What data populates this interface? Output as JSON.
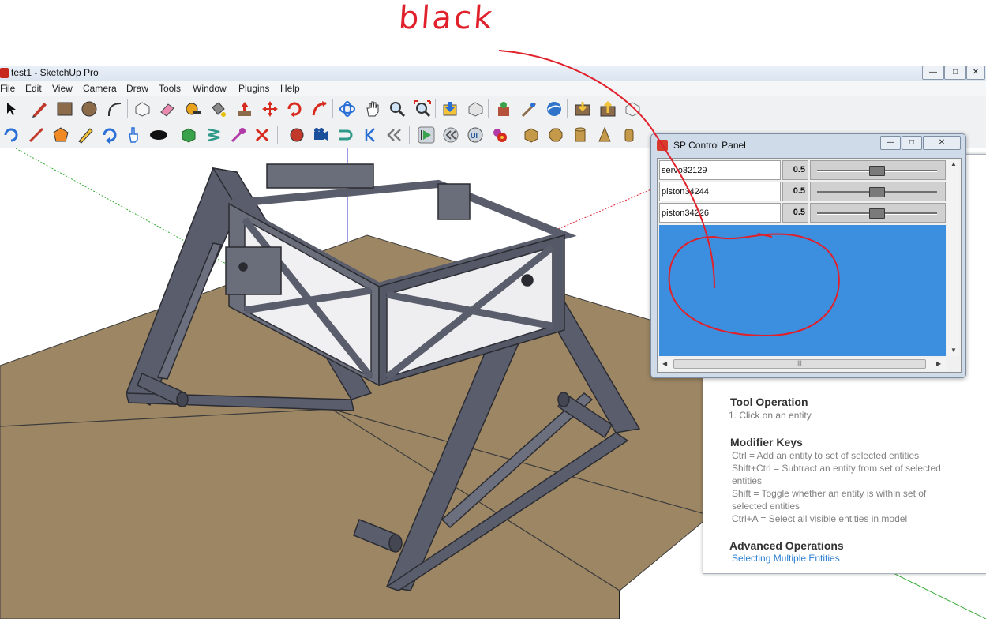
{
  "window": {
    "title": "test1 - SketchUp Pro",
    "controls": [
      "—",
      "□",
      "✕"
    ]
  },
  "menubar": [
    "File",
    "Edit",
    "View",
    "Camera",
    "Draw",
    "Tools",
    "Window",
    "Plugins",
    "Help"
  ],
  "toolbar1_icons": [
    "select-icon",
    "pencil-icon",
    "rectangle-icon",
    "circle-icon",
    "arc-icon",
    "make-component-icon",
    "eraser-icon",
    "tape-measure-icon",
    "paint-bucket-icon",
    "push-pull-icon",
    "move-icon",
    "rotate-icon",
    "follow-me-icon",
    "orbit-icon",
    "pan-icon",
    "zoom-icon",
    "zoom-extents-icon",
    "3d-warehouse-icon",
    "share-model-icon",
    "extension-warehouse-icon",
    "add-location-icon",
    "google-earth-icon",
    "get-models-icon",
    "share-component-icon",
    "dynamic-components-icon"
  ],
  "toolbar2_icons": [
    "orbit-icon",
    "line-icon",
    "polygon-icon",
    "pencil-icon",
    "refresh-icon",
    "hand-icon",
    "ellipse-icon",
    "cube-icon",
    "spring-icon",
    "pin-icon",
    "delete-icon",
    "record-icon",
    "camera-icon",
    "magnet-icon",
    "back-icon",
    "rewind-icon",
    "play-icon",
    "step-back-icon",
    "ui-icon",
    "gear-icon",
    "box-icon",
    "sphere-icon",
    "cylinder-icon",
    "cone-icon",
    "tube-icon"
  ],
  "sp_panel": {
    "title": "SP Control Panel",
    "controls": [
      "—",
      "□",
      "✕"
    ],
    "rows": [
      {
        "name": "servo32129",
        "value": "0.5",
        "slider": 0.5
      },
      {
        "name": "piston34244",
        "value": "0.5",
        "slider": 0.5
      },
      {
        "name": "piston34226",
        "value": "0.5",
        "slider": 0.5
      }
    ],
    "blue_area_color": "#3b8fde",
    "hscroll_grip": "|||"
  },
  "help": {
    "tool_operation_heading": "Tool Operation",
    "tool_operation_step": "1.   Click on an entity.",
    "modifier_heading": "Modifier Keys",
    "modifier_lines": [
      "Ctrl = Add an entity to set of selected entities",
      "Shift+Ctrl = Subtract an entity from set of selected",
      "entities",
      "Shift = Toggle whether an entity is within set of",
      "selected entities",
      "Ctrl+A = Select all visible entities in model"
    ],
    "advanced_heading": "Advanced Operations",
    "advanced_link": "Selecting Multiple Entities"
  },
  "annotation": {
    "text": "black",
    "color": "#e0202a"
  }
}
